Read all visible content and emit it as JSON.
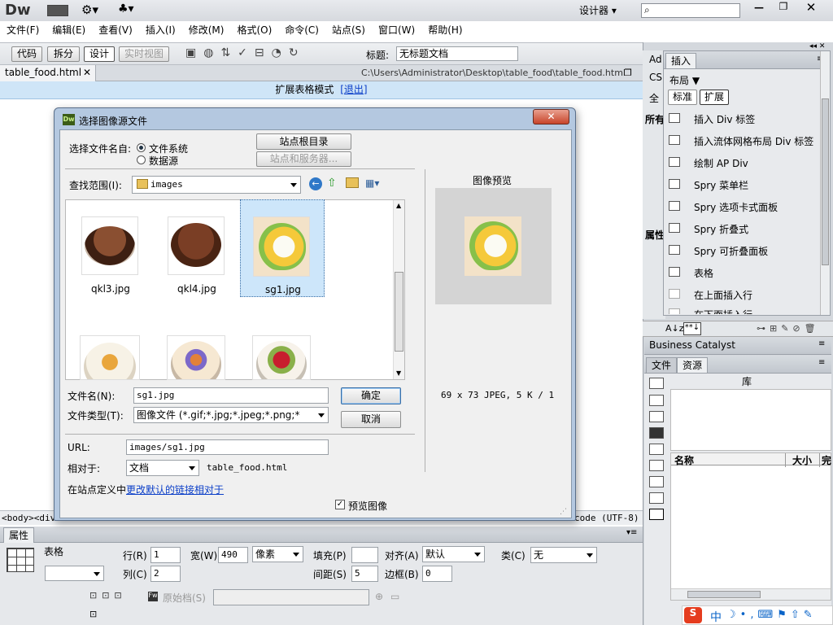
{
  "app": {
    "logo": "Dw",
    "workspace": "设计器",
    "search_placeholder": ""
  },
  "menu": [
    "文件(F)",
    "编辑(E)",
    "查看(V)",
    "插入(I)",
    "修改(M)",
    "格式(O)",
    "命令(C)",
    "站点(S)",
    "窗口(W)",
    "帮助(H)"
  ],
  "toolbar": {
    "code": "代码",
    "split": "拆分",
    "design": "设计",
    "live": "实时视图",
    "title_label": "标题:",
    "title_value": "无标题文档"
  },
  "doc": {
    "tab": "table_food.html",
    "path": "C:\\Users\\Administrator\\Desktop\\table_food\\table_food.html",
    "banner": "扩展表格模式",
    "banner_exit": "[退出]",
    "status_left": "<body><div",
    "status_right": "code (UTF-8)"
  },
  "dialog": {
    "title": "选择图像源文件",
    "select_from_label": "选择文件名自:",
    "radio_fs": "文件系统",
    "radio_ds": "数据源",
    "btn_site_root": "站点根目录",
    "btn_site_server": "站点和服务器...",
    "lookin_label": "查找范围(I):",
    "lookin_value": "images",
    "files": [
      "qkl3.jpg",
      "qkl4.jpg",
      "sg1.jpg"
    ],
    "filename_label": "文件名(N):",
    "filename_value": "sg1.jpg",
    "filetype_label": "文件类型(T):",
    "filetype_value": "图像文件 (*.gif;*.jpg;*.jpeg;*.png;*",
    "ok": "确定",
    "cancel": "取消",
    "url_label": "URL:",
    "url_value": "images/sg1.jpg",
    "relative_label": "相对于:",
    "relative_value": "文档",
    "relative_file": "table_food.html",
    "site_def_prefix": "在站点定义中",
    "site_def_link": "更改默认的链接相对于",
    "preview_title": "图像预览",
    "preview_info": "69 x 73 JPEG, 5 K / 1",
    "preview_check": "预览图像"
  },
  "insert_panel": {
    "tab": "插入",
    "category": "布局",
    "mode_std": "标准",
    "mode_ext": "扩展",
    "items": [
      "插入 Div 标签",
      "插入流体网格布局 Div 标签",
      "绘制 AP Div",
      "Spry 菜单栏",
      "Spry 选项卡式面板",
      "Spry 折叠式",
      "Spry 可折叠面板",
      "表格",
      "在上面插入行",
      "在下面插入行"
    ]
  },
  "left_stub": {
    "a": "Ad",
    "b": "CS",
    "c": "全",
    "d": "所有",
    "e": "属性"
  },
  "bc": {
    "title": "Business Catalyst",
    "tab_files": "文件",
    "tab_assets": "资源",
    "library": "库",
    "col_name": "名称",
    "col_size": "大小",
    "col_full": "完"
  },
  "props": {
    "header": "属性",
    "table_label": "表格",
    "rows_label": "行(R)",
    "rows_value": "1",
    "cols_label": "列(C)",
    "cols_value": "2",
    "width_label": "宽(W)",
    "width_value": "490",
    "width_unit": "像素",
    "pad_label": "填充(P)",
    "pad_value": "",
    "space_label": "间距(S)",
    "space_value": "5",
    "align_label": "对齐(A)",
    "align_value": "默认",
    "border_label": "边框(B)",
    "border_value": "0",
    "class_label": "类(C)",
    "class_value": "无",
    "src_label": "原始档(S)"
  },
  "ime": {
    "lang": "中"
  },
  "colors": {
    "accent": "#0a64c8",
    "banner": "#cfe5f7",
    "dialog_frame": "#b4c8e0",
    "panel": "#d4d8dd"
  }
}
